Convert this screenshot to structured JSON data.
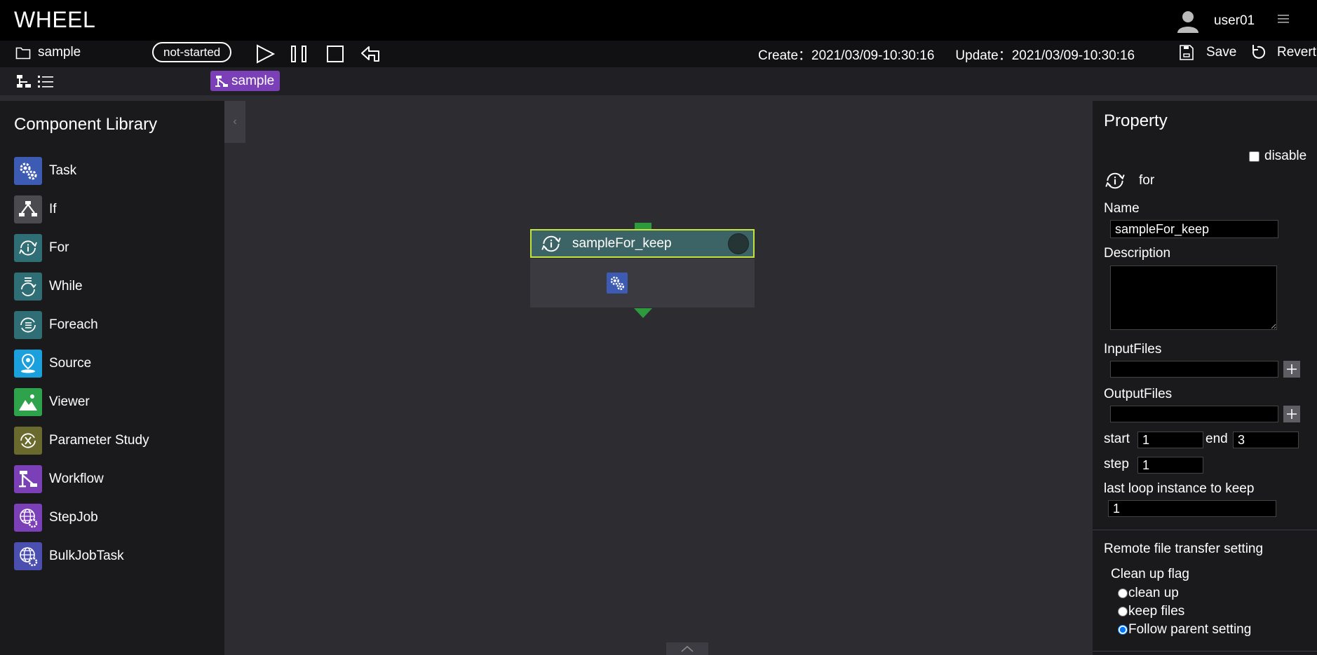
{
  "app": {
    "title": "WHEEL",
    "user": "user01"
  },
  "toolbar": {
    "project_name": "sample",
    "state": "not-started",
    "create_label": "Create：",
    "create_time": "2021/03/09-10:30:16",
    "update_label": "Update：",
    "update_time": "2021/03/09-10:30:16",
    "save_label": "Save",
    "revert_label": "Revert"
  },
  "breadcrumb": {
    "current": "sample"
  },
  "library": {
    "title": "Component Library",
    "items": [
      {
        "label": "Task",
        "icon": "task-icon",
        "color": "#3d5bb3"
      },
      {
        "label": "If",
        "icon": "if-icon",
        "color": "#4a4a4f"
      },
      {
        "label": "For",
        "icon": "for-icon",
        "color": "#2e6e74"
      },
      {
        "label": "While",
        "icon": "while-icon",
        "color": "#2e6e74"
      },
      {
        "label": "Foreach",
        "icon": "foreach-icon",
        "color": "#2e6e74"
      },
      {
        "label": "Source",
        "icon": "source-icon",
        "color": "#1aa0dc"
      },
      {
        "label": "Viewer",
        "icon": "viewer-icon",
        "color": "#2fa34b"
      },
      {
        "label": "Parameter Study",
        "icon": "parameter-study-icon",
        "color": "#6b6a2e"
      },
      {
        "label": "Workflow",
        "icon": "workflow-icon",
        "color": "#7b3fb8"
      },
      {
        "label": "StepJob",
        "icon": "stepjob-icon",
        "color": "#7b3fb8"
      },
      {
        "label": "BulkJobTask",
        "icon": "bulkjobtask-icon",
        "color": "#4a4fb0"
      }
    ]
  },
  "canvas": {
    "node": {
      "name": "sampleFor_keep",
      "type_icon": "for-icon",
      "child_icon": "task-icon"
    }
  },
  "property": {
    "title": "Property",
    "disable_label": "disable",
    "type_label": "for",
    "name_label": "Name",
    "name_value": "sampleFor_keep",
    "description_label": "Description",
    "input_files_label": "InputFiles",
    "output_files_label": "OutputFiles",
    "start_label": "start",
    "start_value": "1",
    "end_label": "end",
    "end_value": "3",
    "step_label": "step",
    "step_value": "1",
    "keep_label": "last loop instance to keep",
    "keep_value": "1",
    "remote_label": "Remote file transfer setting",
    "cleanup_flag_label": "Clean up flag",
    "cleanup_options": [
      "clean up",
      "keep files",
      "Follow parent setting"
    ],
    "cleanup_selected": "Follow parent setting"
  },
  "colors": {
    "topbar": "#000000",
    "panel": "#1a1a1d",
    "canvas": "#2c2c31",
    "for_node": "#3c6466",
    "selected_border": "#c4e33c",
    "port": "#2e9a3e",
    "workflow": "#7b3fb8"
  }
}
